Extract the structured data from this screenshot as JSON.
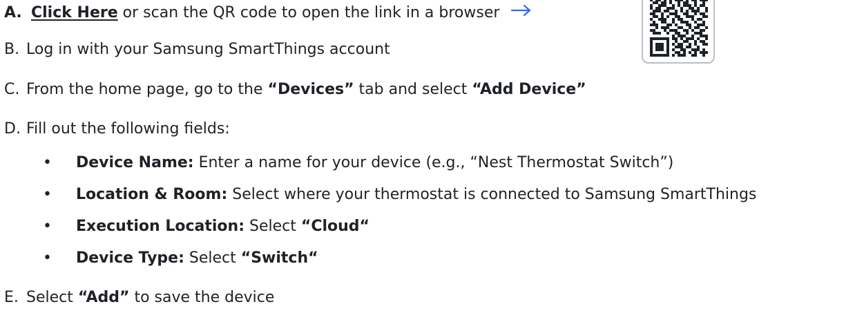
{
  "steps": {
    "a": {
      "marker": "A.",
      "link_text": "Click Here",
      "text": " or scan the QR code to open the link in a browser"
    },
    "b": {
      "marker": "B.",
      "text": "Log in with your Samsung SmartThings account"
    },
    "c": {
      "marker": "C.",
      "text_1": "From the home page, go to the ",
      "bold_1": "“Devices”",
      "text_2": " tab and select ",
      "bold_2": "“Add Device”"
    },
    "d": {
      "marker": "D.",
      "text": "Fill out the following fields:",
      "bullets": [
        {
          "symbol": "•",
          "label": "Device Name:",
          "text": " Enter a name for your device (e.g., “Nest Thermostat Switch”)",
          "bold_value": ""
        },
        {
          "symbol": "•",
          "label": "Location & Room:",
          "text": " Select where your thermostat is connected to Samsung SmartThings",
          "bold_value": ""
        },
        {
          "symbol": "•",
          "label": "Execution Location:",
          "text": " Select ",
          "bold_value": "“Cloud“"
        },
        {
          "symbol": "•",
          "label": "Device Type:",
          "text": " Select ",
          "bold_value": "“Switch“"
        }
      ]
    },
    "e": {
      "marker": "E.",
      "text_1": "Select ",
      "bold_1": "“Add”",
      "text_2": " to save the device"
    }
  },
  "icons": {
    "arrow": "arrow-right-icon",
    "qr": "qr-code-icon"
  },
  "colors": {
    "text": "#1e2126",
    "arrow": "#2d6cf0",
    "qr_border": "#b9bec6"
  }
}
